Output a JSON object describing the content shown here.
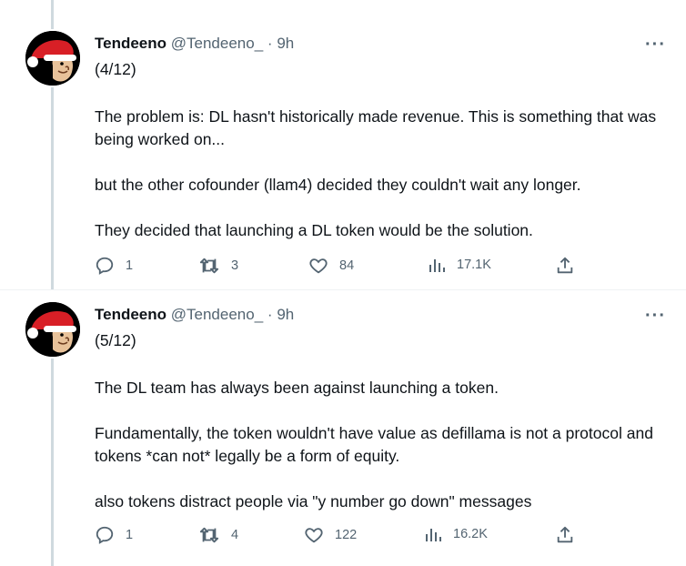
{
  "tweets": [
    {
      "author": {
        "name": "Tendeeno",
        "handle": "@Tendeeno_",
        "time": "9h"
      },
      "counter": "(4/12)",
      "paragraphs": [
        "The problem is: DL hasn't historically made revenue. This is something that was being worked on...",
        "but the other cofounder (llam4) decided they couldn't wait any longer.",
        "They decided that launching a DL token would be the solution."
      ],
      "stats": {
        "replies": "1",
        "retweets": "3",
        "likes": "84",
        "views": "17.1K"
      }
    },
    {
      "author": {
        "name": "Tendeeno",
        "handle": "@Tendeeno_",
        "time": "9h"
      },
      "counter": "(5/12)",
      "paragraphs": [
        "The DL team has always been against launching a token.",
        "Fundamentally, the token wouldn't have value as defillama is not a protocol and tokens *can not* legally be a form of equity.",
        "also tokens distract people via \"y number go down\" messages"
      ],
      "stats": {
        "replies": "1",
        "retweets": "4",
        "likes": "122",
        "views": "16.2K"
      }
    }
  ],
  "separator_dot": "·",
  "more_label": "···",
  "icons": {
    "reply": "reply-icon",
    "retweet": "retweet-icon",
    "like": "heart-icon",
    "views": "views-icon",
    "share": "share-icon",
    "more": "more-icon",
    "avatar": "santa-hat-avatar"
  },
  "colors": {
    "text": "#0f1419",
    "muted": "#536471",
    "thread_line": "#cfd9de"
  }
}
